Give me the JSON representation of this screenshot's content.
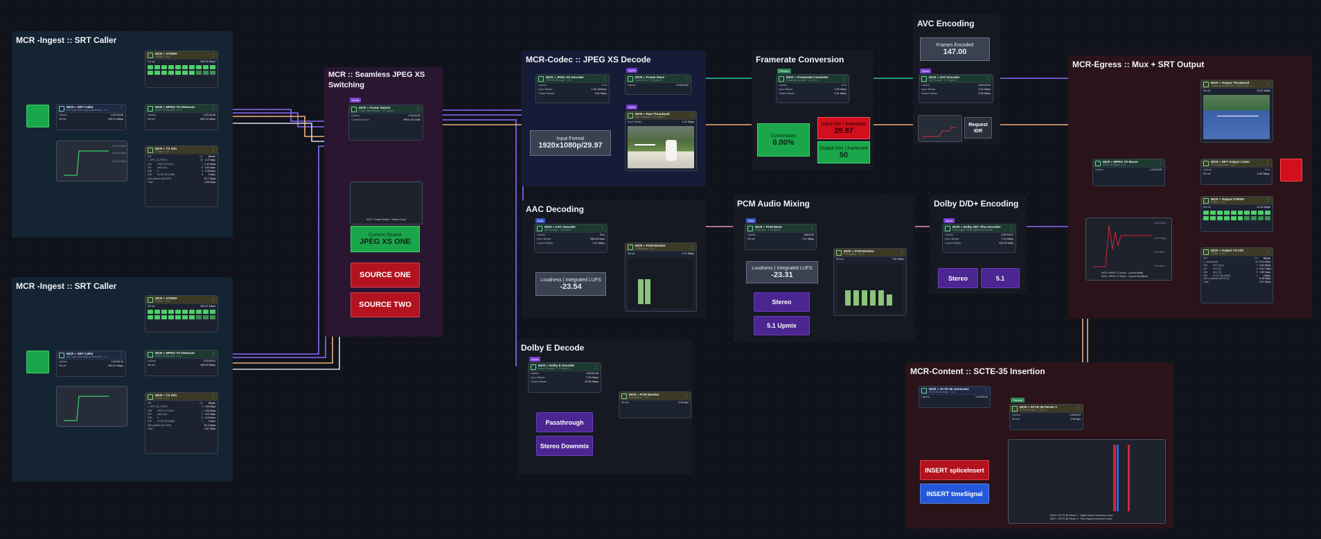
{
  "colors": {
    "teal": "#2ec4a5",
    "purple": "#8e6bff",
    "white": "#d9dde6",
    "pink": "#f08ad6",
    "orange": "#f1b27a",
    "blue": "#49a8f0",
    "green": "#1aa64a",
    "red": "#d10f1d"
  },
  "groups": {
    "ingest1": "MCR -Ingest :: SRT Caller",
    "ingest2": "MCR -Ingest :: SRT Caller",
    "switching": "MCR :: Seamless JPEG XS Switching",
    "codec": "MCR-Codec :: JPEG XS Decode",
    "framerate": "Framerate Conversion",
    "avc": "AVC Encoding",
    "egress": "MCR-Egress :: Mux + SRT Output",
    "aac": "AAC Decoding",
    "pcm": "PCM Audio Mixing",
    "dolbydd": "Dolby D/D+ Encoding",
    "dolbye": "Dolby E Decode",
    "scte": "MCR-Content :: SCTE-35 Insertion"
  },
  "nodes": {
    "st1": {
      "title": "MCR » ST6000",
      "sub": "ST6000 · 1.0.2",
      "k": "Bitrate",
      "v": "300.03 Mbps"
    },
    "srt1": {
      "title": "MCR » SRT Caller",
      "sub": "SRT Input Caller (high performance) · 1.0...",
      "k1": "Uptime",
      "v1": "1:03:08:46",
      "k2": "Bitrate",
      "v2": "200.13 Mbps"
    },
    "dem1": {
      "title": "MCR » MPEG TS Demuxer",
      "sub": "MPEG TS Demuxer · 1.0.2",
      "k1": "Uptime",
      "v1": "1:03:08:46",
      "k2": "Bitrate",
      "v2": "200.13 Mbps"
    },
    "ts1": {
      "title": "MCR » TS Info",
      "sub": "TS Info · 1.0.3",
      "head": [
        "PID",
        "",
        "CC",
        "Bitrate"
      ],
      "rows": [
        [
          "1 -SRT_ID_PROG",
          "",
          "36",
          "1.47 kbps"
        ],
        [
          "256",
          "JPEG XS (0x2)",
          "7",
          "1.44 Mbps"
        ],
        [
          "257",
          "AAC (0x)",
          "8",
          "3.87 kbps"
        ],
        [
          "258",
          "0",
          "0",
          "2.48 kbps"
        ],
        [
          "300",
          "SCTE-35 (0x86)",
          "8",
          "0 kbps"
        ],
        [
          "Null packets (38.60%)",
          "",
          "",
          "81.7 Mbps"
        ],
        [
          "Total",
          "",
          "",
          "1.88 Gbps"
        ]
      ]
    },
    "st2": {
      "title": "MCR » ST6000",
      "sub": "ST6000 · 1.0.2",
      "k": "Bitrate",
      "v": "199.37 Mbps"
    },
    "srt2": {
      "title": "MCR » SRT Caller",
      "sub": "SRT Input Caller (high performance) · 1.0...",
      "k1": "Uptime",
      "v1": "1:00:03:11",
      "k2": "Bitrate",
      "v2": "200.44 Mbps"
    },
    "dem2": {
      "title": "MCR » MPEG TS Demuxer",
      "sub": "MPEG TS Demuxer · 1.0.2",
      "k1": "Uptime",
      "v1": "1:03:53:11",
      "k2": "Bitrate",
      "v2": "199.93 Mbps"
    },
    "ts2": {
      "title": "MCR » TS Info",
      "sub": "TS Info · 1.0.3",
      "head": [
        "PID",
        "",
        "CC",
        "Bitrate"
      ],
      "rows": [
        [
          "1 -SRT_ID_PROG",
          "",
          "8",
          "1.56 Mbps"
        ],
        [
          "256",
          "JPEG XS (0x2)",
          "1",
          "1.56 Mbps"
        ],
        [
          "257",
          "AAC (0x)",
          "5",
          "3.67 kbps"
        ],
        [
          "258",
          "0",
          "4",
          "3.42 kbps"
        ],
        [
          "300",
          "SCTE-35 (0x86)",
          "7",
          "0 kbps"
        ],
        [
          "Null packets (38.40%)",
          "",
          "",
          "81.2 Mbps"
        ],
        [
          "Total",
          "",
          "",
          "1.87 Gbps"
        ]
      ]
    },
    "fsw": {
      "title": "MCR » Frame Switch",
      "sub": "Frame Switch Module · 12.0 alpha 4",
      "k1": "Uptime",
      "v1": "1:03:53:23",
      "k2": "Current Source",
      "v2": "JPEG XS ONE",
      "badge": "Alpha"
    },
    "xsdec": {
      "title": "MCR » JPEG XS Decoder",
      "sub": "JPEG XS Decoder · 1.0.0",
      "k1": "Uptime",
      "v1": "17 s",
      "k2": "Input Bitrate",
      "v2": "1.50 Gbit/sec",
      "k3": "Output Bitrate",
      "v3": "1.50 Mbps"
    },
    "fstore": {
      "title": "MCR » Frame Store",
      "sub": "Frame Store · 1.0.0 alpha 2",
      "k1": "Uptime",
      "v1": "1:03:53:43",
      "badge": "Alpha"
    },
    "rawthumb": {
      "title": "MCR » Raw Thumbnail",
      "sub": "Raw Thumbnail · 0.1.1 alpha 2",
      "k": "Input Bitrate",
      "v": "1.10 Mbps",
      "badge": "Alpha"
    },
    "frc": {
      "title": "MCR » Framerate Converter",
      "sub": "Framerate Converter · 1.0.0 rc 4",
      "k1": "Uptime",
      "v1": "17 s",
      "k2": "Input Bitrate",
      "v2": "1.39 Mbps",
      "k3": "Output Bitrate",
      "v3": "2.31 Mbps",
      "badge": "Preview"
    },
    "avcenc": {
      "title": "MCR » AVC Encoder",
      "sub": "AVC Encoder · 1.1.0 alpha 1",
      "k1": "Uptime",
      "v1": "1:00:09:44",
      "k2": "Input Bitrate",
      "v2": "2.33 Mbps",
      "k3": "Output Bitrate",
      "v3": "2.35 Mbps",
      "badge": "Alpha"
    },
    "aacdec": {
      "title": "MCR » AAC Decoder",
      "sub": "AAC Decoder · 1.0.0 beta 1",
      "k1": "Uptime",
      "v1": "18 s",
      "k2": "Input Bitrate",
      "v2": "386.98 kbps",
      "k3": "Output Bitrate",
      "v3": "1.41 Mbps",
      "badge": "Beta"
    },
    "pcmmon1": {
      "title": "MCR » PCM Monitor",
      "sub": "PCM Monitor · 1.0.0",
      "k": "Bitrate",
      "v": "1.41 Mbps"
    },
    "pcmmix": {
      "title": "MCR » PCM Mixer",
      "sub": "PCM Mixer · 2.0.0 alpha 3",
      "k1": "Uptime",
      "v1": "18s/5.00",
      "k2": "Bitrate",
      "v2": "7.10 Mbps",
      "badge": "Beta"
    },
    "pcmmon2": {
      "title": "MCR » PCM Monitor",
      "sub": "PCM Monitor · 1.0.0",
      "k": "Bitrate",
      "v": "7.30 Mbps"
    },
    "dolbyenc": {
      "title": "MCR » Dolby DD+ Plus Encoder",
      "sub": "Dolby Digital / Dolby Digital Plus Encode...",
      "k1": "Uptime",
      "v1": "1:00:53:21",
      "k2": "Input Bitrate",
      "v2": "7.10 Mbps",
      "k3": "Output Bitrate",
      "v3": "443.09 kbps",
      "badge": "Alpha"
    },
    "dedec": {
      "title": "MCR » Dolby E Decoder",
      "sub": "Dolby E Decoder · 1.0.0 alpha 1",
      "k1": "Uptime",
      "v1": "1:03:53:49",
      "k2": "Input Bitrate",
      "v2": "2.39 Mbps",
      "k3": "Output Bitrate",
      "v3": "22.59 Mbps",
      "badge": "Alpha"
    },
    "pcmmon3": {
      "title": "MCR » PCM Monitor",
      "sub": "PCM Monitor · 1.0.0",
      "k": "Bitrate",
      "v": "0.00 bps"
    },
    "muxer": {
      "title": "MCR » MPEG TS Muxer",
      "sub": "MPEG TS Muxer · 1.4.1",
      "k1": "Uptime",
      "v1": "1:03:30:07"
    },
    "outthumb": {
      "title": "MCR » Output Thumbnail",
      "sub": "Thumbnail module (AVC / MPEG-2 vid...)",
      "k": "Bitrate",
      "v": "13.02 Mbps"
    },
    "srtout": {
      "title": "MCR » SRT Output Listen",
      "sub": "SRT Output Listen · 1.0.3",
      "k1": "Uptime",
      "v1": "17 s",
      "k2": "Bitrate",
      "v2": "6.82 Mbps"
    },
    "outst": {
      "title": "MCR » Output ST6000",
      "sub": "ST6000 · 1.0.3",
      "k": "Bitrate",
      "v": "12.03 Mbps"
    },
    "outts": {
      "title": "MCR » Output TS Info",
      "sub": "TS Info · 1.0.3",
      "head": [
        "PID",
        "",
        "CC",
        "Bitrate"
      ],
      "rows": [
        [
          "1 -Indiamedia",
          "",
          "38",
          "5.13 Mbps"
        ],
        [
          "256",
          "AVC (0x1)",
          "7",
          "4.61 Mbps"
        ],
        [
          "257",
          "AC3 (0)",
          "8",
          "140.7 kbps"
        ],
        [
          "258",
          "AAC (0)",
          "9",
          "0.87 kbps"
        ],
        [
          "300",
          "SCTE-35 (0x86)",
          "1",
          "0 kbps"
        ],
        [
          "NULL packets (38.47%)",
          "",
          "",
          "6.48 Mbps"
        ],
        [
          "Total",
          "",
          "",
          "13.0 Mbps"
        ]
      ]
    },
    "sctegen": {
      "title": "MCR » SCTE-35 Generator",
      "sub": "SCTE-35 Generator · 1.0.1",
      "k1": "Uptime",
      "v1": "1:03:53:14"
    },
    "scteparse": {
      "title": "MCR » SCTE-35 Parser 2",
      "sub": "SCTE-35 Parser · 1.2.3 rc 2",
      "k1": "Uptime",
      "v1": "1:03:53:3",
      "k2": "Bitrate",
      "v2": "0.00 bps",
      "badge": "Preview"
    }
  },
  "widgets": {
    "switchStatus": "MCR » Frame Switch · Switch Count",
    "currentSource": {
      "label": "Current Source",
      "value": "JPEG XS ONE"
    },
    "sourceOne": "SOURCE ONE",
    "sourceTwo": "SOURCE TWO",
    "inputFormat": {
      "label": "Input Format",
      "value": "1920x1080p/29.97"
    },
    "concession": {
      "label": "Concession",
      "value": "0.00%"
    },
    "inputFramerate": {
      "label": "Input Info | framerate",
      "value": "29.97"
    },
    "outputFramerate": {
      "label": "Output Info | framerate",
      "value": "50"
    },
    "framesEncoded": {
      "label": "Frames Encoded",
      "value": "147.00"
    },
    "requestIdr": "Request IDR",
    "loudness1": {
      "label": "Loudness | Integrated LUFS",
      "value": "-23.54"
    },
    "loudness2": {
      "label": "Loudness | Integrated LUFS",
      "value": "-23.31"
    },
    "stereo": "Stereo",
    "upmix": "5.1 Upmix",
    "dolbyStereo": "Stereo",
    "dolby51": "5.1",
    "passthrough": "Passthrough",
    "stereoDownmix": "Stereo Downmix",
    "insertSplice": "INSERT spliceInsert",
    "insertTimeSignal": "INSERT timeSignal"
  },
  "charts": {
    "ingest1": {
      "labels": [
        "200.13 Mbps",
        "150.00 Mbps",
        "100.00 Mbps"
      ]
    },
    "egress": {
      "labels": [
        "13.00 Mbps",
        "10.00 Mbps",
        "5.00 Mbps",
        "0.00 Mbps"
      ],
      "legend1": "MCR » MPEG TS Muxer · Current Bitrate",
      "legend2": "MCR » MPEG TS Muxer · Current Null Bitrate"
    },
    "scte": {
      "legend1": "MCR » SCTE-35 Parser 2 · Splice Insert Command Count",
      "legend2": "MCR » SCTE-35 Parser 2 · Time Signal Command Count"
    }
  }
}
